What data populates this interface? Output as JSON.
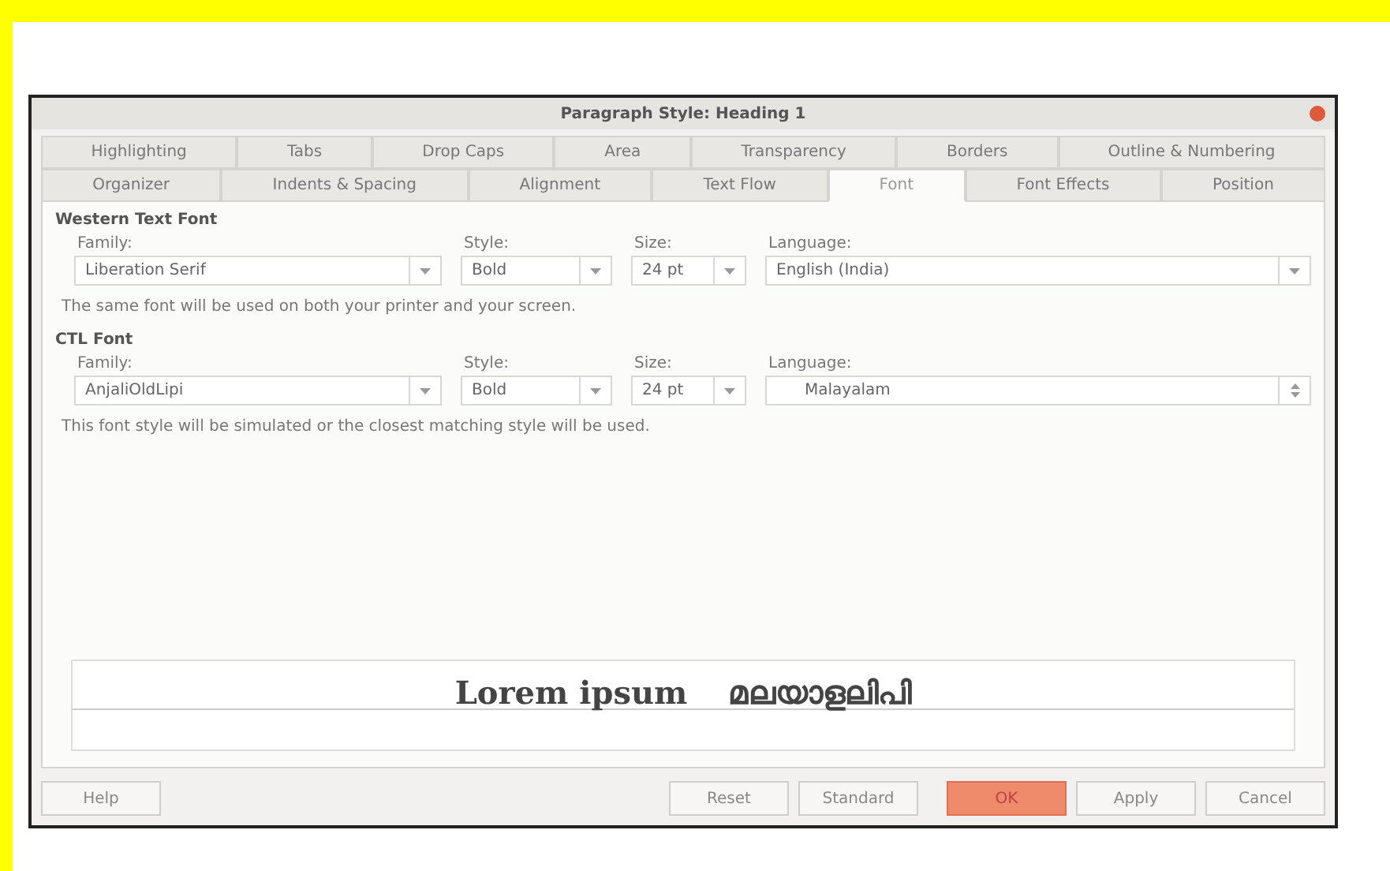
{
  "window": {
    "title": "Paragraph Style: Heading 1"
  },
  "tab_rows": [
    [
      {
        "label": "Highlighting",
        "selected": false
      },
      {
        "label": "Tabs",
        "selected": false
      },
      {
        "label": "Drop Caps",
        "selected": false
      },
      {
        "label": "Area",
        "selected": false
      },
      {
        "label": "Transparency",
        "selected": false
      },
      {
        "label": "Borders",
        "selected": false
      },
      {
        "label": "Outline & Numbering",
        "selected": false
      }
    ],
    [
      {
        "label": "Organizer",
        "selected": false
      },
      {
        "label": "Indents & Spacing",
        "selected": false
      },
      {
        "label": "Alignment",
        "selected": false
      },
      {
        "label": "Text Flow",
        "selected": false
      },
      {
        "label": "Font",
        "selected": true
      },
      {
        "label": "Font Effects",
        "selected": false
      },
      {
        "label": "Position",
        "selected": false
      }
    ]
  ],
  "sections": [
    {
      "heading": "Western Text Font",
      "family_label": "Family:",
      "family": "Liberation Serif",
      "style_label": "Style:",
      "style": "Bold",
      "size_label": "Size:",
      "size": "24 pt",
      "language_label": "Language:",
      "language": {
        "value": "English (India)",
        "kind": "dropdown"
      },
      "note": "The same font will be used on both your printer and your screen."
    },
    {
      "heading": "CTL Font",
      "family_label": "Family:",
      "family": "AnjaliOldLipi",
      "style_label": "Style:",
      "style": "Bold",
      "size_label": "Size:",
      "size": "24 pt",
      "language_label": "Language:",
      "language": {
        "value": "Malayalam",
        "kind": "spinner"
      },
      "note": "This font style will be simulated or the closest matching style will be used."
    }
  ],
  "preview": {
    "western": "Lorem ipsum",
    "ctl": "മലയാളലിപി"
  },
  "buttons": [
    {
      "label": "Help",
      "kind": "left"
    },
    {
      "label": "Reset",
      "kind": "normal"
    },
    {
      "label": "Standard",
      "kind": "normal"
    },
    {
      "label": "OK",
      "kind": "default"
    },
    {
      "label": "Apply",
      "kind": "normal"
    },
    {
      "label": "Cancel",
      "kind": "normal"
    }
  ]
}
